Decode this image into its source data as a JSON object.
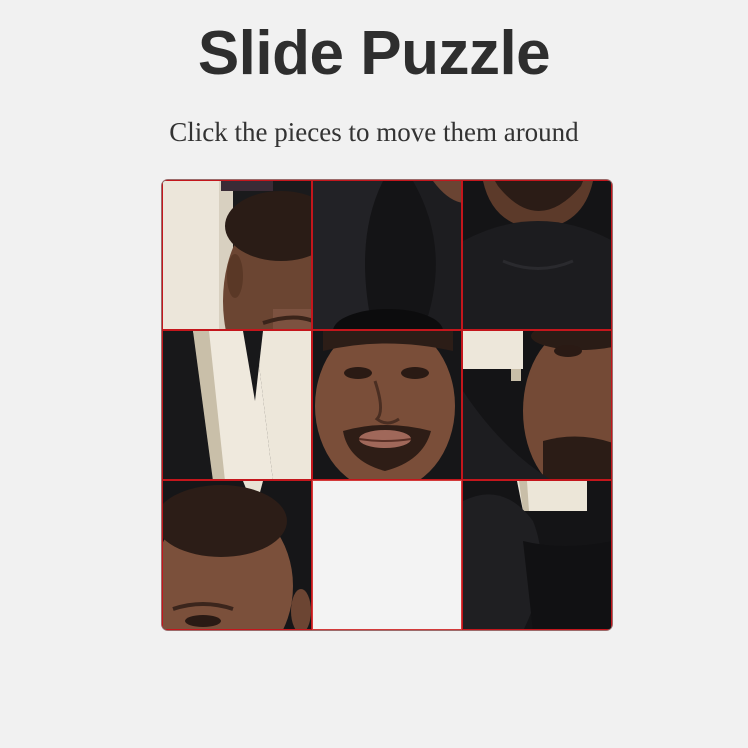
{
  "header": {
    "title": "Slide Puzzle",
    "instructions": "Click the pieces to move them around"
  },
  "puzzle": {
    "grid_size": 3,
    "empty_slot": "row 3, column 2",
    "tile_count": 9,
    "colors": {
      "tile_border": "#c4161c",
      "background": "#f1f1f1",
      "empty_tile": "#f3f3f3"
    }
  }
}
